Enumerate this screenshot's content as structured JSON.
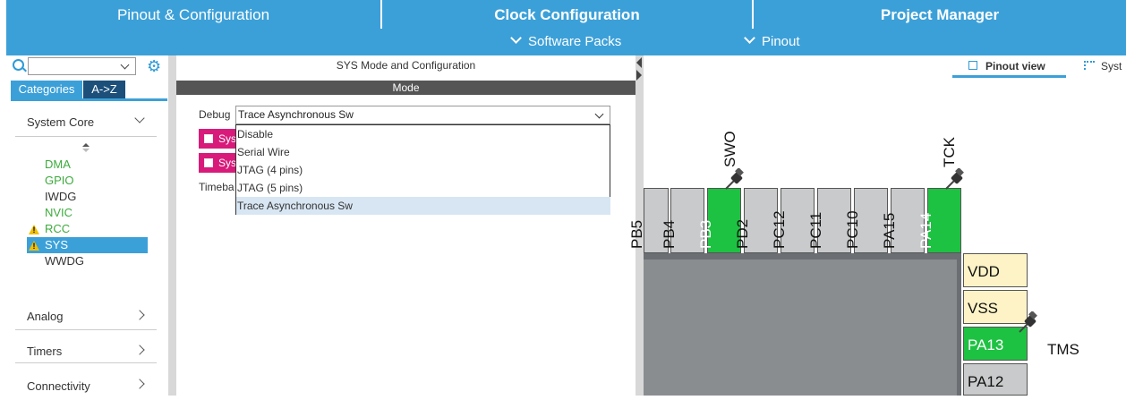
{
  "tabs": {
    "pinout": "Pinout & Configuration",
    "clock": "Clock Configuration",
    "project": "Project Manager"
  },
  "subnav": {
    "software_packs": "Software Packs",
    "pinout": "Pinout"
  },
  "sidebar": {
    "search_placeholder": "",
    "tab_categories": "Categories",
    "tab_az": "A->Z",
    "system_core": "System Core",
    "items": [
      "DMA",
      "GPIO",
      "IWDG",
      "NVIC",
      "RCC",
      "SYS",
      "WWDG"
    ],
    "analog": "Analog",
    "timers": "Timers",
    "connectivity": "Connectivity"
  },
  "mode_panel": {
    "title": "SYS Mode and Configuration",
    "mode_header": "Mode",
    "debug_label": "Debug",
    "debug_value": "Trace Asynchronous Sw",
    "checkbox1": "Sys",
    "checkbox2": "Sys",
    "timebase_label": "Timeba",
    "options": [
      "Disable",
      "Serial Wire",
      "JTAG (4 pins)",
      "JTAG (5 pins)",
      "Trace Asynchronous Sw"
    ]
  },
  "pinout": {
    "view_tab": "Pinout view",
    "system_tab": "Syst",
    "top_pins": [
      "PB5",
      "PB4",
      "PB3",
      "PD2",
      "PC12",
      "PC11",
      "PC10",
      "PA15",
      "PA14"
    ],
    "right_pins": [
      "VDD",
      "VSS",
      "PA13",
      "PA12"
    ],
    "signal_swo": "SWO",
    "signal_tck": "TCK",
    "signal_tms": "TMS"
  },
  "colors": {
    "accent": "#3ca0d8",
    "pin_green": "#1ec242",
    "pin_gray": "#c8cacb",
    "pin_yellow": "#fdf3c7",
    "warning": "#f0c000",
    "pink": "#d81b7a"
  }
}
